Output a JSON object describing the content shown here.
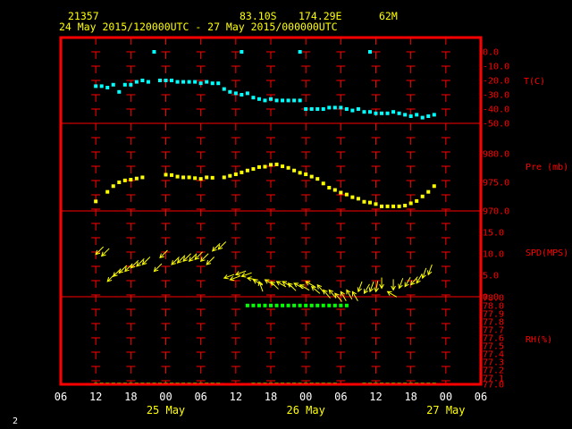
{
  "header": {
    "station_id": "21357",
    "latitude": "83.10S",
    "longitude": "174.29E",
    "elevation": "62M",
    "period": "24 May 2015/120000UTC - 27 May 2015/000000UTC"
  },
  "footer_label": "2",
  "colors": {
    "frame": "#ff0000",
    "grid": "#ff0000",
    "temperature": "#00ffff",
    "pressure": "#ffff00",
    "wind": "#ffff00",
    "rh": "#00ff00",
    "tick_labels": "#ffffff",
    "day_labels": "#ffff00"
  },
  "chart_data": {
    "type": "scatter",
    "x_unit": "hours UTC",
    "x_range": [
      "2015-05-24T06:00Z",
      "2015-05-27T06:00Z"
    ],
    "x_tick_labels": [
      "06",
      "12",
      "18",
      "00",
      "06",
      "12",
      "18",
      "00",
      "06",
      "12",
      "18",
      "00",
      "06"
    ],
    "day_labels": [
      "25 May",
      "26 May",
      "27 May"
    ],
    "grid": true,
    "panels": [
      {
        "id": "temperature",
        "label": "T(C)",
        "ticks": [
          "0.0",
          "-10.0",
          "-20.0",
          "-30.0",
          "-40.0",
          "-50.0"
        ],
        "ylim": [
          -50,
          0
        ],
        "points": [
          [
            "2015-05-24T12:00Z",
            -24
          ],
          [
            "2015-05-24T13:00Z",
            -24
          ],
          [
            "2015-05-24T14:00Z",
            -25
          ],
          [
            "2015-05-24T15:00Z",
            -23
          ],
          [
            "2015-05-24T16:00Z",
            -28
          ],
          [
            "2015-05-24T17:00Z",
            -23
          ],
          [
            "2015-05-24T18:00Z",
            -23
          ],
          [
            "2015-05-24T19:00Z",
            -21
          ],
          [
            "2015-05-24T20:00Z",
            -20
          ],
          [
            "2015-05-24T21:00Z",
            -21
          ],
          [
            "2015-05-24T23:00Z",
            -20
          ],
          [
            "2015-05-25T00:00Z",
            -20
          ],
          [
            "2015-05-25T01:00Z",
            -20
          ],
          [
            "2015-05-25T02:00Z",
            -21
          ],
          [
            "2015-05-25T03:00Z",
            -21
          ],
          [
            "2015-05-25T04:00Z",
            -21
          ],
          [
            "2015-05-25T05:00Z",
            -21
          ],
          [
            "2015-05-25T06:00Z",
            -22
          ],
          [
            "2015-05-25T07:00Z",
            -21
          ],
          [
            "2015-05-25T08:00Z",
            -22
          ],
          [
            "2015-05-25T09:00Z",
            -22
          ],
          [
            "2015-05-25T10:00Z",
            -26
          ],
          [
            "2015-05-25T11:00Z",
            -28
          ],
          [
            "2015-05-25T12:00Z",
            -29
          ],
          [
            "2015-05-25T13:00Z",
            -30
          ],
          [
            "2015-05-25T14:00Z",
            -29
          ],
          [
            "2015-05-25T15:00Z",
            -32
          ],
          [
            "2015-05-25T16:00Z",
            -33
          ],
          [
            "2015-05-25T17:00Z",
            -34
          ],
          [
            "2015-05-25T18:00Z",
            -33
          ],
          [
            "2015-05-25T19:00Z",
            -34
          ],
          [
            "2015-05-25T20:00Z",
            -34
          ],
          [
            "2015-05-25T21:00Z",
            -34
          ],
          [
            "2015-05-25T22:00Z",
            -34
          ],
          [
            "2015-05-25T23:00Z",
            -34
          ],
          [
            "2015-05-26T00:00Z",
            -40
          ],
          [
            "2015-05-26T01:00Z",
            -40
          ],
          [
            "2015-05-26T02:00Z",
            -40
          ],
          [
            "2015-05-26T03:00Z",
            -40
          ],
          [
            "2015-05-26T04:00Z",
            -39
          ],
          [
            "2015-05-26T05:00Z",
            -39
          ],
          [
            "2015-05-26T06:00Z",
            -39
          ],
          [
            "2015-05-26T07:00Z",
            -40
          ],
          [
            "2015-05-26T08:00Z",
            -41
          ],
          [
            "2015-05-26T09:00Z",
            -40
          ],
          [
            "2015-05-26T10:00Z",
            -42
          ],
          [
            "2015-05-26T11:00Z",
            -42
          ],
          [
            "2015-05-26T12:00Z",
            -43
          ],
          [
            "2015-05-26T13:00Z",
            -43
          ],
          [
            "2015-05-26T14:00Z",
            -43
          ],
          [
            "2015-05-26T15:00Z",
            -42
          ],
          [
            "2015-05-26T16:00Z",
            -43
          ],
          [
            "2015-05-26T17:00Z",
            -44
          ],
          [
            "2015-05-26T18:00Z",
            -45
          ],
          [
            "2015-05-26T19:00Z",
            -44
          ],
          [
            "2015-05-26T20:00Z",
            -46
          ],
          [
            "2015-05-26T21:00Z",
            -45
          ],
          [
            "2015-05-26T22:00Z",
            -44
          ]
        ],
        "isolated_points": [
          [
            "2015-05-24T22:00Z",
            0
          ],
          [
            "2015-05-25T13:00Z",
            0
          ],
          [
            "2015-05-25T23:00Z",
            0
          ],
          [
            "2015-05-26T11:00Z",
            0
          ]
        ]
      },
      {
        "id": "pressure",
        "label": "Pre (mb)",
        "ticks": [
          "980.0",
          "975.0",
          "970.0"
        ],
        "ylim": [
          969,
          984
        ],
        "points": [
          [
            "2015-05-24T12:00Z",
            971.5
          ],
          [
            "2015-05-24T14:00Z",
            974.0
          ],
          [
            "2015-05-24T15:00Z",
            975.5
          ],
          [
            "2015-05-24T16:00Z",
            976.5
          ],
          [
            "2015-05-24T17:00Z",
            977.0
          ],
          [
            "2015-05-24T18:00Z",
            977.2
          ],
          [
            "2015-05-24T19:00Z",
            977.5
          ],
          [
            "2015-05-24T20:00Z",
            977.8
          ],
          [
            "2015-05-25T00:00Z",
            978.5
          ],
          [
            "2015-05-25T01:00Z",
            978.4
          ],
          [
            "2015-05-25T02:00Z",
            978.0
          ],
          [
            "2015-05-25T03:00Z",
            977.8
          ],
          [
            "2015-05-25T04:00Z",
            977.8
          ],
          [
            "2015-05-25T05:00Z",
            977.6
          ],
          [
            "2015-05-25T06:00Z",
            977.4
          ],
          [
            "2015-05-25T07:00Z",
            977.8
          ],
          [
            "2015-05-25T08:00Z",
            977.7
          ],
          [
            "2015-05-25T10:00Z",
            977.8
          ],
          [
            "2015-05-25T11:00Z",
            978.2
          ],
          [
            "2015-05-25T12:00Z",
            978.6
          ],
          [
            "2015-05-25T13:00Z",
            979.1
          ],
          [
            "2015-05-25T14:00Z",
            979.6
          ],
          [
            "2015-05-25T15:00Z",
            980.0
          ],
          [
            "2015-05-25T16:00Z",
            980.5
          ],
          [
            "2015-05-25T17:00Z",
            980.6
          ],
          [
            "2015-05-25T18:00Z",
            981.1
          ],
          [
            "2015-05-25T19:00Z",
            981.2
          ],
          [
            "2015-05-25T20:00Z",
            980.7
          ],
          [
            "2015-05-25T21:00Z",
            980.3
          ],
          [
            "2015-05-25T22:00Z",
            979.6
          ],
          [
            "2015-05-25T23:00Z",
            979.0
          ],
          [
            "2015-05-26T00:00Z",
            978.6
          ],
          [
            "2015-05-26T01:00Z",
            978.0
          ],
          [
            "2015-05-26T02:00Z",
            977.4
          ],
          [
            "2015-05-26T03:00Z",
            976.2
          ],
          [
            "2015-05-26T04:00Z",
            975.1
          ],
          [
            "2015-05-26T05:00Z",
            974.5
          ],
          [
            "2015-05-26T06:00Z",
            973.8
          ],
          [
            "2015-05-26T07:00Z",
            973.3
          ],
          [
            "2015-05-26T08:00Z",
            972.6
          ],
          [
            "2015-05-26T09:00Z",
            972.2
          ],
          [
            "2015-05-26T10:00Z",
            971.4
          ],
          [
            "2015-05-26T11:00Z",
            971.2
          ],
          [
            "2015-05-26T12:00Z",
            970.8
          ],
          [
            "2015-05-26T13:00Z",
            970.2
          ],
          [
            "2015-05-26T14:00Z",
            970.2
          ],
          [
            "2015-05-26T15:00Z",
            970.2
          ],
          [
            "2015-05-26T16:00Z",
            970.2
          ],
          [
            "2015-05-26T17:00Z",
            970.4
          ],
          [
            "2015-05-26T18:00Z",
            971.0
          ],
          [
            "2015-05-26T19:00Z",
            971.6
          ],
          [
            "2015-05-26T20:00Z",
            972.8
          ],
          [
            "2015-05-26T21:00Z",
            974.0
          ],
          [
            "2015-05-26T22:00Z",
            975.5
          ]
        ]
      },
      {
        "id": "wind",
        "label": "SPD(MPS)",
        "ticks": [
          "15.0",
          "10.0",
          "5.0",
          "0.0"
        ],
        "ylim": [
          0,
          19
        ],
        "vectors": [
          [
            "2015-05-24T12:00Z",
            12.5,
            225
          ],
          [
            "2015-05-24T13:00Z",
            12.0,
            225
          ],
          [
            "2015-05-24T14:00Z",
            4.5,
            225
          ],
          [
            "2015-05-24T15:00Z",
            6.0,
            225
          ],
          [
            "2015-05-24T16:00Z",
            7.0,
            225
          ],
          [
            "2015-05-24T17:00Z",
            7.5,
            225
          ],
          [
            "2015-05-24T18:00Z",
            8.5,
            225
          ],
          [
            "2015-05-24T19:00Z",
            9.0,
            225
          ],
          [
            "2015-05-24T20:00Z",
            9.5,
            225
          ],
          [
            "2015-05-24T22:00Z",
            7.5,
            225
          ],
          [
            "2015-05-24T23:00Z",
            11.5,
            225
          ],
          [
            "2015-05-25T01:00Z",
            9.5,
            225
          ],
          [
            "2015-05-25T02:00Z",
            10.0,
            225
          ],
          [
            "2015-05-25T03:00Z",
            10.5,
            225
          ],
          [
            "2015-05-25T04:00Z",
            10.5,
            225
          ],
          [
            "2015-05-25T05:00Z",
            11.0,
            225
          ],
          [
            "2015-05-25T06:00Z",
            10.5,
            225
          ],
          [
            "2015-05-25T07:00Z",
            9.5,
            225
          ],
          [
            "2015-05-25T08:00Z",
            13.5,
            225
          ],
          [
            "2015-05-25T09:00Z",
            14.0,
            225
          ],
          [
            "2015-05-25T10:00Z",
            5.5,
            250
          ],
          [
            "2015-05-25T11:00Z",
            5.0,
            250
          ],
          [
            "2015-05-25T12:00Z",
            6.5,
            250
          ],
          [
            "2015-05-25T13:00Z",
            6.0,
            250
          ],
          [
            "2015-05-25T14:00Z",
            5.5,
            280
          ],
          [
            "2015-05-25T15:00Z",
            5.0,
            300
          ],
          [
            "2015-05-25T16:00Z",
            4.5,
            340
          ],
          [
            "2015-05-25T17:00Z",
            5.0,
            300
          ],
          [
            "2015-05-25T18:00Z",
            4.5,
            315
          ],
          [
            "2015-05-25T19:00Z",
            4.5,
            300
          ],
          [
            "2015-05-25T20:00Z",
            4.5,
            300
          ],
          [
            "2015-05-25T21:00Z",
            4.0,
            315
          ],
          [
            "2015-05-25T22:00Z",
            4.0,
            300
          ],
          [
            "2015-05-25T23:00Z",
            3.5,
            300
          ],
          [
            "2015-05-26T00:00Z",
            4.5,
            300
          ],
          [
            "2015-05-26T01:00Z",
            3.0,
            310
          ],
          [
            "2015-05-26T02:00Z",
            3.5,
            320
          ],
          [
            "2015-05-26T03:00Z",
            2.0,
            320
          ],
          [
            "2015-05-26T04:00Z",
            2.0,
            320
          ],
          [
            "2015-05-26T05:00Z",
            1.0,
            320
          ],
          [
            "2015-05-26T06:00Z",
            1.5,
            330
          ],
          [
            "2015-05-26T07:00Z",
            2.0,
            330
          ],
          [
            "2015-05-26T08:00Z",
            1.5,
            330
          ],
          [
            "2015-05-26T09:00Z",
            1.5,
            200
          ],
          [
            "2015-05-26T10:00Z",
            1.0,
            210
          ],
          [
            "2015-05-26T11:00Z",
            1.5,
            200
          ],
          [
            "2015-05-26T12:00Z",
            1.5,
            190
          ],
          [
            "2015-05-26T13:00Z",
            2.5,
            180
          ],
          [
            "2015-05-26T14:00Z",
            1.5,
            300
          ],
          [
            "2015-05-26T15:00Z",
            2.0,
            180
          ],
          [
            "2015-05-26T16:00Z",
            2.5,
            200
          ],
          [
            "2015-05-26T17:00Z",
            3.0,
            210
          ],
          [
            "2015-05-26T18:00Z",
            3.5,
            220
          ],
          [
            "2015-05-26T19:00Z",
            4.0,
            210
          ],
          [
            "2015-05-26T20:00Z",
            5.5,
            200
          ],
          [
            "2015-05-26T21:00Z",
            6.5,
            200
          ]
        ]
      },
      {
        "id": "rh",
        "label": "RH(%)",
        "ticks": [
          "78.0",
          "78.0",
          "77.9",
          "77.8",
          "77.7",
          "77.6",
          "77.5",
          "77.4",
          "77.3",
          "77.2",
          "77.1",
          "77.0"
        ],
        "ylim": [
          77.0,
          78.1
        ],
        "upper_run": {
          "from": "2015-05-25T14:00Z",
          "to": "2015-05-26T07:00Z",
          "value": 78.0
        },
        "lower_run": {
          "from": "2015-05-24T12:00Z",
          "to": "2015-05-26T22:00Z",
          "value": 77.0
        },
        "lower_gaps": [
          [
            "2015-05-25T10:00Z",
            "2015-05-25T14:00Z"
          ],
          [
            "2015-05-26T06:00Z",
            "2015-05-26T09:00Z"
          ]
        ]
      }
    ]
  }
}
